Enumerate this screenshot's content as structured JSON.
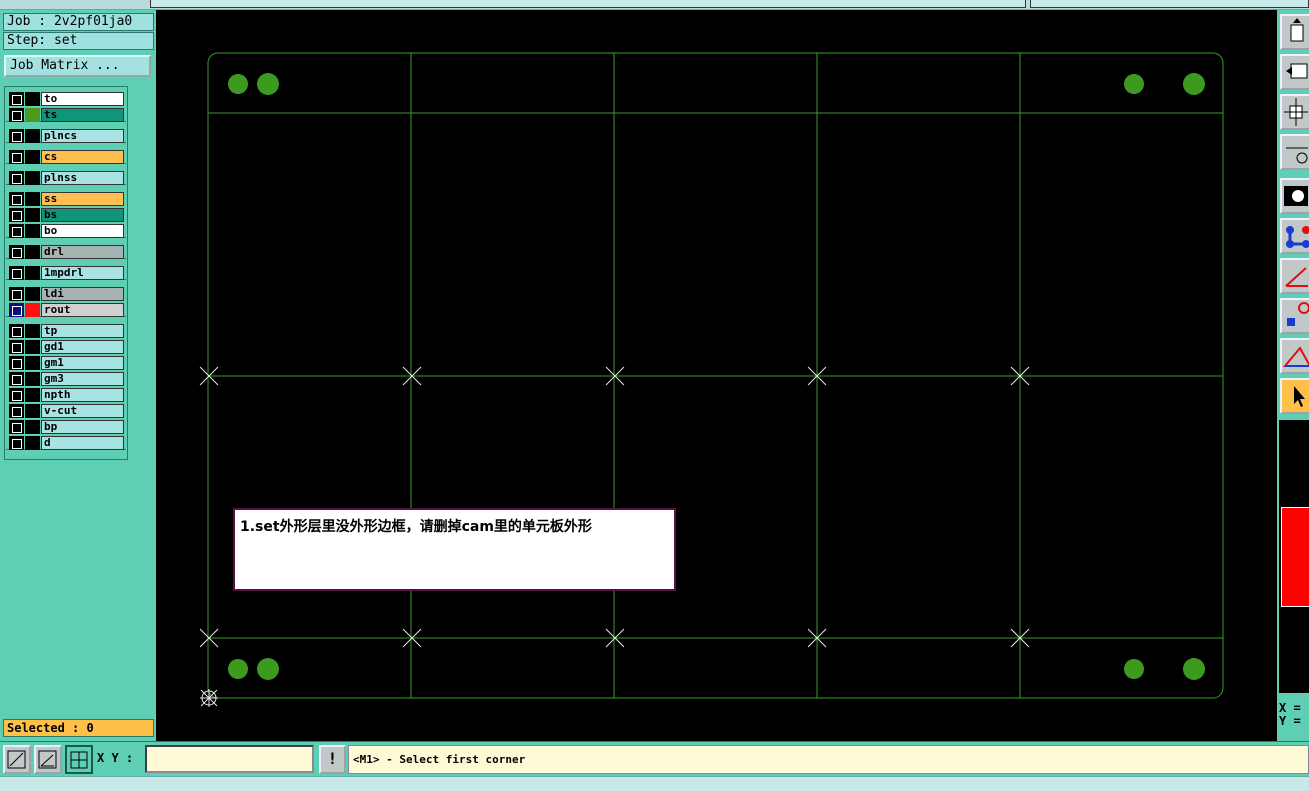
{
  "job_label": "Job : 2v2pf01ja0",
  "step_label": "Step: set",
  "job_matrix_label": "Job Matrix ...",
  "layers": [
    {
      "name": "to",
      "color": "#ffffff",
      "swatch": "#000000"
    },
    {
      "name": "ts",
      "color": "#10957a",
      "swatch": "#4c9a1e"
    },
    {
      "name": "plncs",
      "color": "#a9e2e2",
      "swatch": "#000000"
    },
    {
      "name": "cs",
      "color": "#ffbe50",
      "swatch": "#000000"
    },
    {
      "name": "plnss",
      "color": "#a9e2e2",
      "swatch": "#000000"
    },
    {
      "name": "ss",
      "color": "#ffbe50",
      "swatch": "#000000"
    },
    {
      "name": "bs",
      "color": "#10957a",
      "swatch": "#000000"
    },
    {
      "name": "bo",
      "color": "#ffffff",
      "swatch": "#000000"
    },
    {
      "name": "drl",
      "color": "#a7b3b3",
      "swatch": "#000000"
    },
    {
      "name": "1mpdrl",
      "color": "#a9e2e2",
      "swatch": "#000000"
    },
    {
      "name": "ldi",
      "color": "#a7b3b3",
      "swatch": "#000000"
    },
    {
      "name": "rout",
      "color": "#d0d0d0",
      "swatch": "#ff1010"
    },
    {
      "name": "tp",
      "color": "#a9e2e2",
      "swatch": "#000000"
    },
    {
      "name": "gd1",
      "color": "#a9e2e2",
      "swatch": "#000000"
    },
    {
      "name": "gm1",
      "color": "#a9e2e2",
      "swatch": "#000000"
    },
    {
      "name": "gm3",
      "color": "#a9e2e2",
      "swatch": "#000000"
    },
    {
      "name": "npth",
      "color": "#a9e2e2",
      "swatch": "#000000"
    },
    {
      "name": "v-cut",
      "color": "#a9e2e2",
      "swatch": "#000000"
    },
    {
      "name": "bp",
      "color": "#a9e2e2",
      "swatch": "#000000"
    },
    {
      "name": "d",
      "color": "#a9e2e2",
      "swatch": "#000000"
    }
  ],
  "selected_label": "Selected : 0",
  "note_text": "1.set外形层里没外形边框，请删掉cam里的单元板外形",
  "coords": {
    "x_label": "X =",
    "y_label": "Y ="
  },
  "xy_label": "X Y :",
  "xy_value": "",
  "status_text": "<M1> - Select first corner",
  "colors": {
    "outline": "#3c9a2e",
    "pad": "#3c9a1e",
    "background": "#000000",
    "panel": "#5fcfb4"
  }
}
